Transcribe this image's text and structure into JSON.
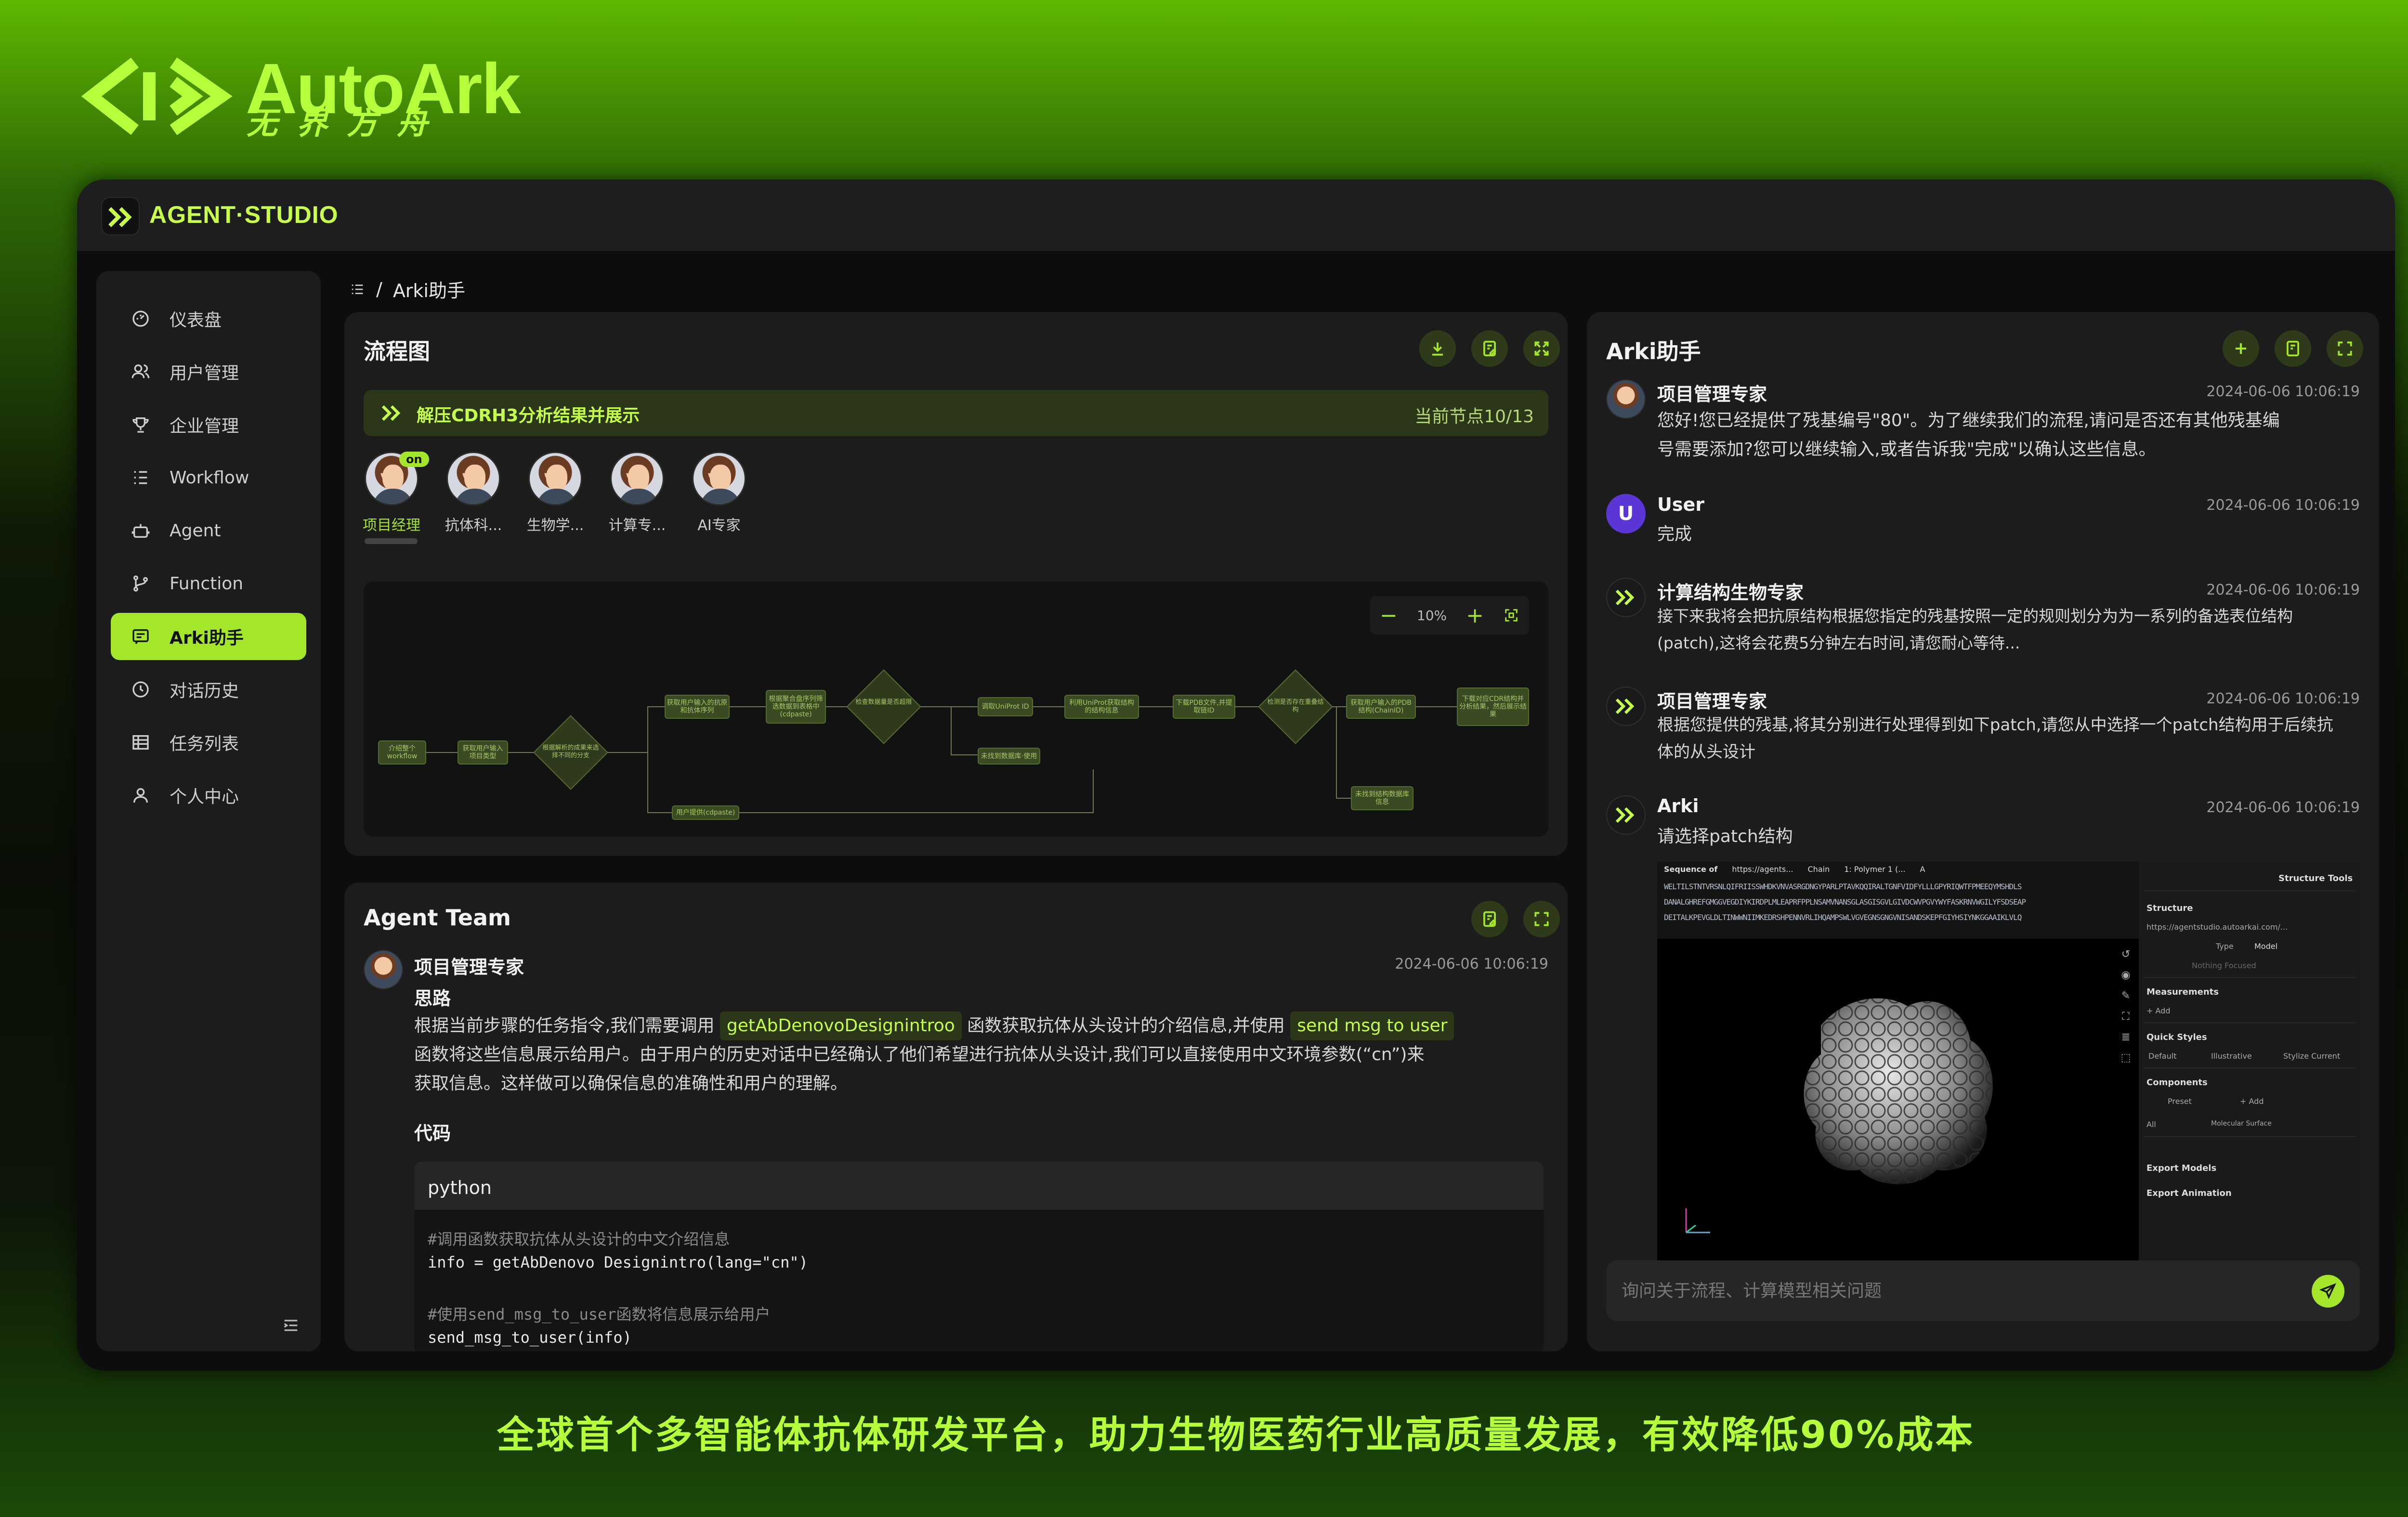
{
  "brand": {
    "name_en": "AutoArk",
    "name_cn": "无界方舟"
  },
  "app": {
    "name": "AGENT·STUDIO"
  },
  "sidebar": {
    "items": [
      {
        "label": "仪表盘",
        "icon": "dashboard-icon"
      },
      {
        "label": "用户管理",
        "icon": "users-icon"
      },
      {
        "label": "企业管理",
        "icon": "trophy-icon"
      },
      {
        "label": "Workflow",
        "icon": "list-icon"
      },
      {
        "label": "Agent",
        "icon": "robot-icon"
      },
      {
        "label": "Function",
        "icon": "branch-icon"
      },
      {
        "label": "Arki助手",
        "icon": "chat-icon",
        "active": true
      },
      {
        "label": "对话历史",
        "icon": "clock-icon"
      },
      {
        "label": "任务列表",
        "icon": "table-icon"
      },
      {
        "label": "个人中心",
        "icon": "person-icon"
      }
    ]
  },
  "breadcrumb": {
    "separator": "/",
    "current": "Arki助手"
  },
  "flow": {
    "title": "流程图",
    "banner_text": "解压CDRH3分析结果并展示",
    "node_progress": "当前节点10/13",
    "agents": [
      {
        "label": "项目经理",
        "badge": "on",
        "active": true
      },
      {
        "label": "抗体科..."
      },
      {
        "label": "生物学..."
      },
      {
        "label": "计算专..."
      },
      {
        "label": "AI专家"
      }
    ],
    "zoom": "10%",
    "nodes": [
      "介绍整个workflow",
      "获取用户输入项目类型",
      "根据解析的成果来选择不同的分支",
      "获取用户输入的抗原和抗体序列",
      "根据聚合盘序列筛选数据到表格中(cdpaste)",
      "检查数据量是否超限",
      "调取UniProt ID",
      "利用UniProt获取结构的结构信息",
      "下载PDB文件,并提取链ID",
      "检测是否存在重叠结构",
      "获取用户输入的PDB结构(ChainID)",
      "下载对应CDR结构并分析结果，然后展示结果",
      "用户提供(cdpaste)",
      "未找到数据库·使用",
      "未找到结构数据库信息"
    ]
  },
  "team": {
    "title": "Agent Team",
    "name": "项目管理专家",
    "time": "2024-06-06 10:06:19",
    "thought_label": "思路",
    "thought_pre": "根据当前步骤的任务指令,我们需要调用",
    "func1": "getAbDenovoDesignintroo",
    "thought_mid": "函数获取抗体从头设计的介绍信息,并使用",
    "func2": "send msg to user",
    "thought_line2": "函数将这些信息展示给用户。由于用户的历史对话中已经确认了他们希望进行抗体从头设计,我们可以直接使用中文环境参数(“cn”)来",
    "thought_line3": "获取信息。这样做可以确保信息的准确性和用户的理解。",
    "code_label": "代码",
    "code_lang": "python",
    "code_lines": [
      {
        "kind": "comment",
        "text": "#调用函数获取抗体从头设计的中文介绍信息"
      },
      {
        "kind": "code",
        "text": "info = getAbDenovo Designintro(lang=\"cn\")"
      },
      {
        "kind": "blank",
        "text": ""
      },
      {
        "kind": "comment",
        "text": "#使用send_msg_to_user函数将信息展示给用户"
      },
      {
        "kind": "code",
        "text": "send_msg_to_user(info)"
      }
    ]
  },
  "chat": {
    "title": "Arki助手",
    "messages": [
      {
        "sender": "项目管理专家",
        "time": "2024-06-06 10:06:19",
        "lines": [
          "您好!您已经提供了残基编号\"80\"。为了继续我们的流程,请问是否还有其他残基编",
          "号需要添加?您可以继续输入,或者告诉我\"完成\"以确认这些信息。"
        ]
      },
      {
        "sender": "User",
        "avatar_letter": "U",
        "time": "2024-06-06 10:06:19",
        "lines": [
          "完成"
        ]
      },
      {
        "sender": "计算结构生物专家",
        "time": "2024-06-06 10:06:19",
        "lines": [
          "接下来我将会把抗原结构根据您指定的残基按照一定的规则划分为为一系列的备选表位结构",
          "(patch),这将会花费5分钟左右时间,请您耐心等待..."
        ]
      },
      {
        "sender": "项目管理专家",
        "time": "2024-06-06 10:06:19",
        "lines": [
          "根据您提供的残基,将其分别进行处理得到如下patch,请您从中选择一个patch结构用于后续抗",
          "体的从头设计"
        ]
      },
      {
        "sender": "Arki",
        "time": "2024-06-06 10:06:19",
        "lines": [
          "请选择patch结构"
        ]
      }
    ],
    "input_placeholder": "询问关于流程、计算模型相关问题"
  },
  "viewer": {
    "seq_label": "Sequence of",
    "seq_source": "https://agents...",
    "chain_label": "Chain",
    "chain_value": "1: Polymer 1 (...",
    "chain_id": "A",
    "seq_lines": [
      "WELTILSTNTVRSNLQIFRIISSWHDKVNVASRGDNGYPARLPTAVKQQIRALTGNFVIDFYLLLGPYRIQWTFPMEEQYMSHDLS",
      "DANALGHREFGMGGVEGDIYKIRDPLMLEAPRFPPLNSAMVNANSGLASGISGVLGIVDCWVPGVYWYFASKRNVWGILYFSDSEAP",
      "DEITALKPEVGLDLTINWWNIIMKEDRSHPENNVRLIHQAMPSWLVGVEGNSGNGVNISANDSKEPFGIYHSIYNKGGAAIKLVLQ"
    ],
    "tools_title": "Structure Tools",
    "structure_label": "Structure",
    "structure_url": "https://agentstudio.autoarkai.com/...",
    "type_label": "Type",
    "type_value": "Model",
    "focus_placeholder": "Nothing Focused",
    "measurements": "Measurements",
    "add": "+ Add",
    "quick_styles": "Quick Styles",
    "styles": [
      "Default",
      "Illustrative",
      "Stylize Current"
    ],
    "components": "Components",
    "preset": "Preset",
    "all": "All",
    "surface": "Molecular Surface",
    "export_models": "Export Models",
    "export_animation": "Export Animation"
  },
  "tagline": "全球首个多智能体抗体研发平台，助力生物医药行业高质量发展，有效降低90%成本",
  "colors": {
    "accent": "#a4e62a",
    "brand_green": "#b6ff3b",
    "panel": "#1c1c1c",
    "user_avatar": "#5b35d6"
  }
}
